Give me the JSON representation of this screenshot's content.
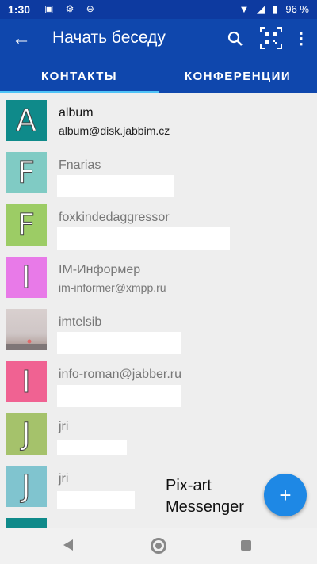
{
  "status_bar": {
    "time": "1:30",
    "left_icons": "▣ ⚙ ⊖",
    "wifi": "▼",
    "signal": "◢",
    "battery_icon": "▮",
    "battery_percent": "96 %"
  },
  "appbar": {
    "back_icon": "←",
    "title": "Начать беседу",
    "more_icon": "⋮"
  },
  "tabs": [
    {
      "label": "КОНТАКТЫ"
    },
    {
      "label": "КОНФЕРЕНЦИИ"
    }
  ],
  "contacts": [
    {
      "letter": "A",
      "name": "album",
      "sub": "album@disk.jabbim.cz",
      "color": "#0f8a8a",
      "dark": true
    },
    {
      "letter": "F",
      "name": "Fnarias",
      "sub": "",
      "color": "#80cbc4",
      "dark": false
    },
    {
      "letter": "F",
      "name": "foxkindedaggressor",
      "sub": "",
      "color": "#9ccc65",
      "dark": false
    },
    {
      "letter": "I",
      "name": "IM-Информер",
      "sub": "im-informer@xmpp.ru",
      "color": "#e87ae8",
      "dark": false
    },
    {
      "letter": "",
      "name": "imtelsib",
      "sub": "",
      "color": "#cfc6c6",
      "dark": false
    },
    {
      "letter": "I",
      "name": "info-roman@jabber.ru",
      "sub": "",
      "color": "#f06292",
      "dark": false
    },
    {
      "letter": "J",
      "name": "jri",
      "sub": "",
      "color": "#a5c26b",
      "dark": false
    },
    {
      "letter": "J",
      "name": "jri",
      "sub": "",
      "color": "#80c4cf",
      "dark": false
    }
  ],
  "watermark": {
    "line1": "Pix-art",
    "line2": "Messenger"
  },
  "fab": {
    "icon": "+"
  }
}
